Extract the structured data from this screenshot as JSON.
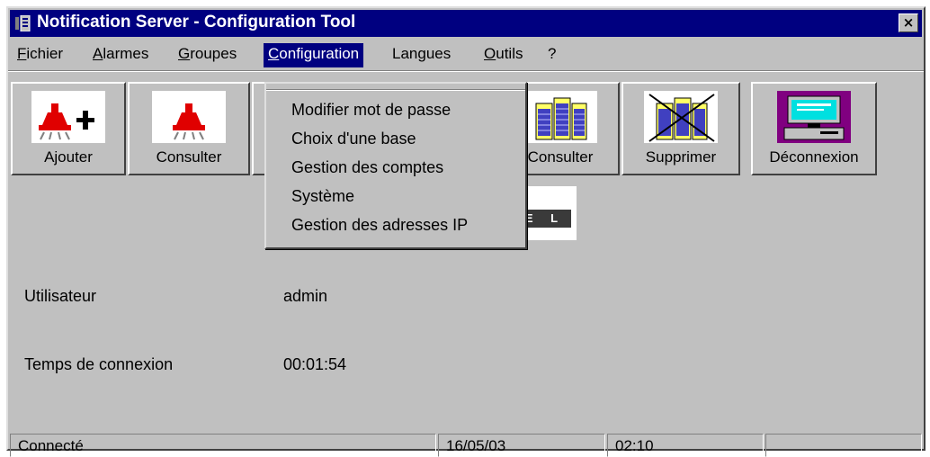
{
  "window": {
    "title": "Notification Server - Configuration Tool",
    "close_glyph": "×"
  },
  "menubar": {
    "items": [
      {
        "label": "Fichier",
        "mnemonic": "F",
        "rest": "ichier"
      },
      {
        "label": "Alarmes",
        "mnemonic": "A",
        "rest": "larmes"
      },
      {
        "label": "Groupes",
        "mnemonic": "G",
        "rest": "roupes"
      },
      {
        "label": "Configuration",
        "mnemonic": "C",
        "rest": "onfiguration"
      },
      {
        "label": "Langues",
        "mnemonic": "",
        "rest": "Langues"
      },
      {
        "label": "Outils",
        "mnemonic": "O",
        "rest": "utils"
      },
      {
        "label": "?",
        "mnemonic": "",
        "rest": "?"
      }
    ],
    "active": "Configuration"
  },
  "toolbar": {
    "ajouter": "Ajouter",
    "consulter_alarmes": "Consulter",
    "consulter_groupes": "Consulter",
    "supprimer": "Supprimer",
    "deconnexion": "Déconnexion"
  },
  "logo": {
    "text": "E L"
  },
  "configuration_menu": {
    "items": [
      "Modifier mot de passe",
      "Choix d'une base",
      "Gestion des comptes",
      "Système",
      "Gestion des adresses IP"
    ]
  },
  "info": {
    "user_label": "Utilisateur",
    "user_value": "admin",
    "time_label": "Temps de connexion",
    "time_value": "00:01:54"
  },
  "statusbar": {
    "state": "Connecté",
    "date": "16/05/03",
    "time": "02:10",
    "extra": ""
  },
  "colors": {
    "title_bar": "#000080",
    "window_face": "#c0c0c0",
    "alarm_red": "#e00000",
    "monitor_purple": "#800080",
    "building_yellow": "#ffff66"
  }
}
